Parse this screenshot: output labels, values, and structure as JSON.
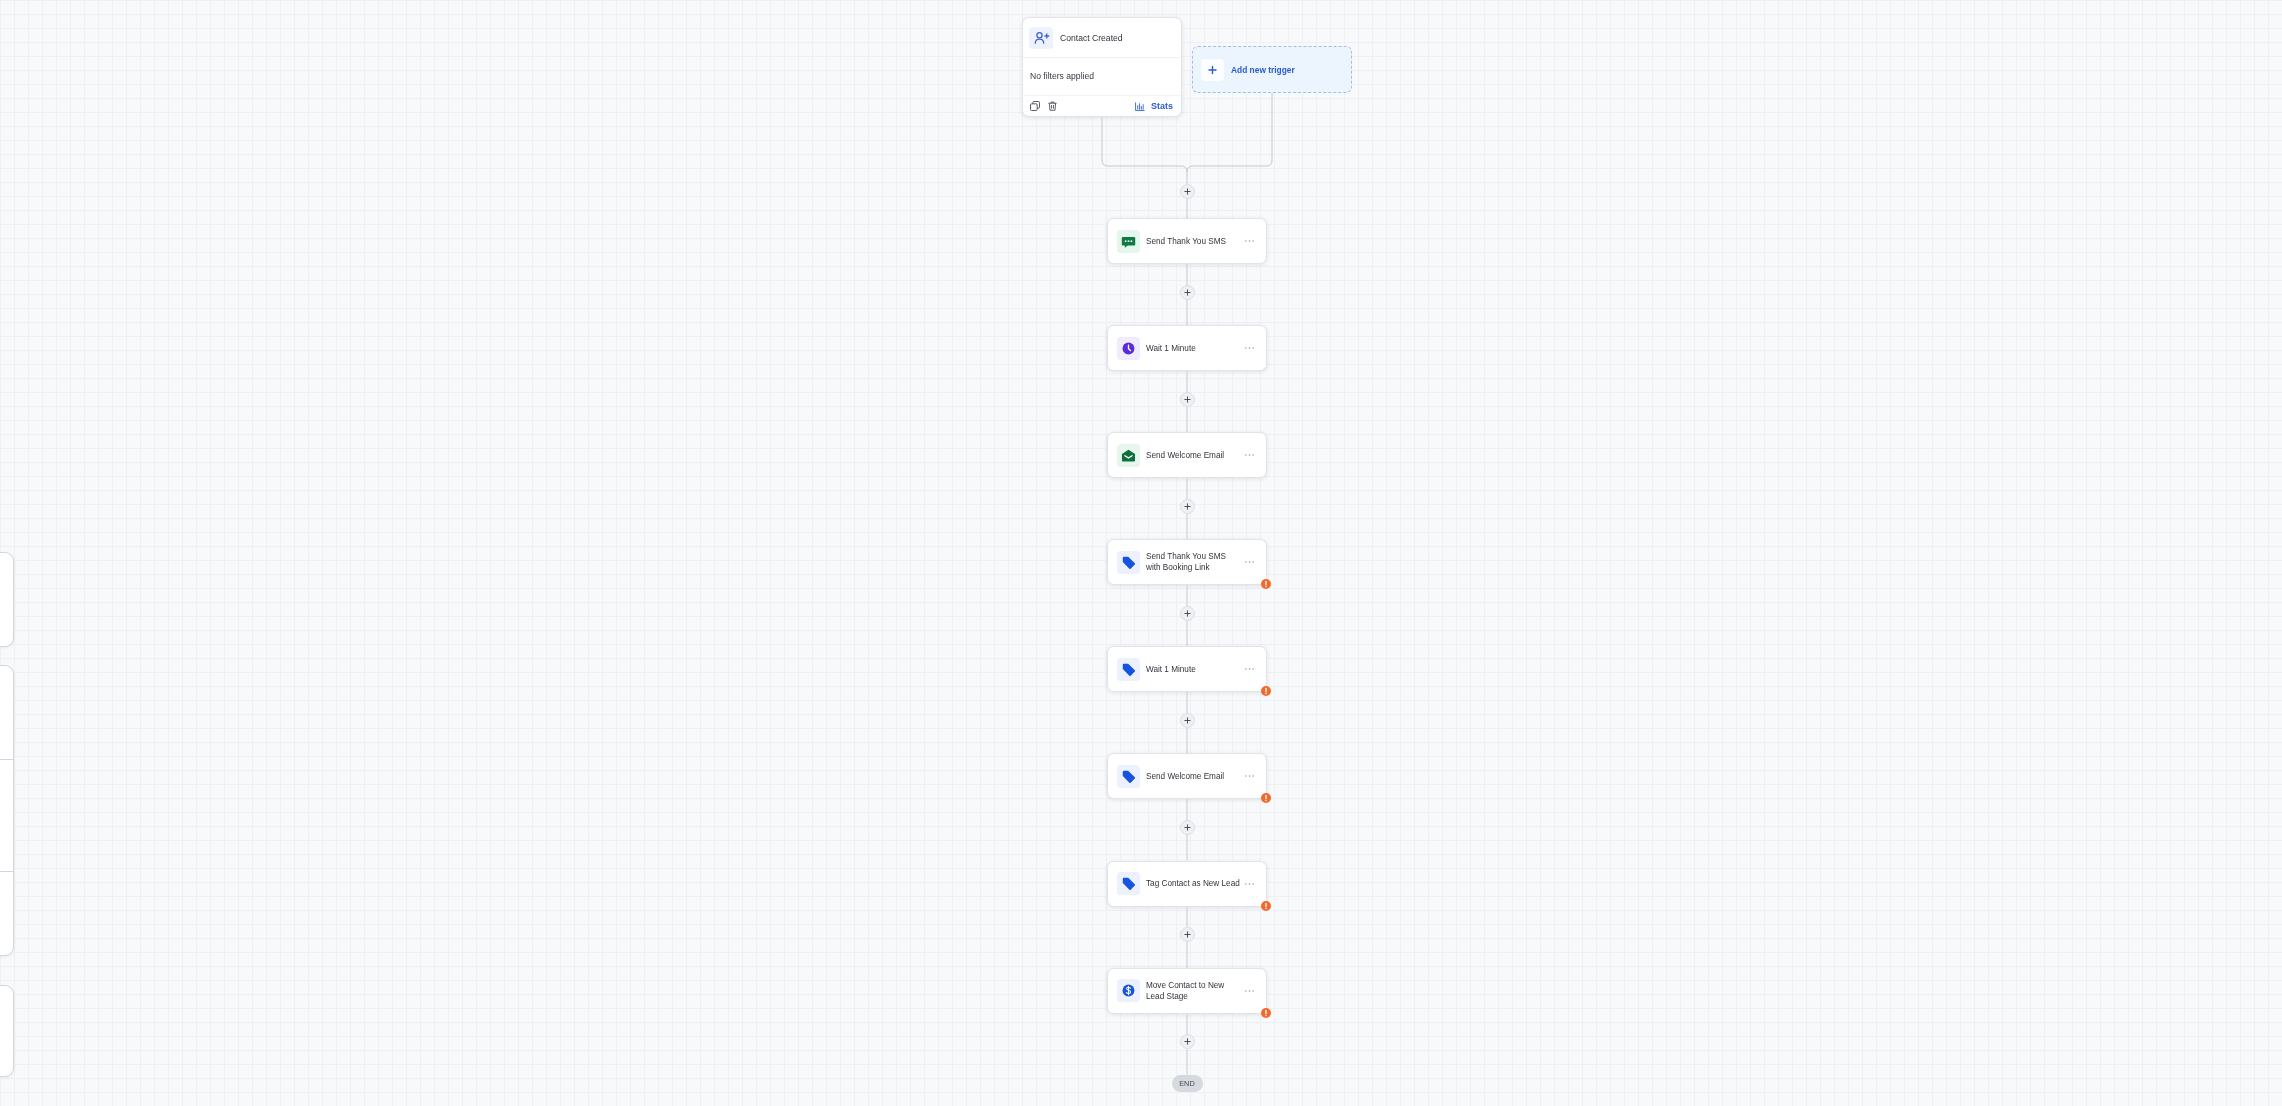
{
  "trigger": {
    "title": "Contact Created",
    "filter_summary": "No filters applied",
    "stats_label": "Stats"
  },
  "add_trigger": {
    "label": "Add new trigger"
  },
  "steps": [
    {
      "kind": "sms",
      "label": "Send Thank You SMS",
      "warning": false
    },
    {
      "kind": "wait",
      "label": "Wait 1 Minute",
      "warning": false
    },
    {
      "kind": "email",
      "label": "Send Welcome Email",
      "warning": false
    },
    {
      "kind": "tag",
      "label": "Send Thank You SMS with Booking Link",
      "warning": true
    },
    {
      "kind": "tag",
      "label": "Wait 1 Minute",
      "warning": true
    },
    {
      "kind": "tag",
      "label": "Send Welcome Email",
      "warning": true
    },
    {
      "kind": "tag",
      "label": "Tag Contact as New Lead",
      "warning": true
    },
    {
      "kind": "opportunity",
      "label": "Move Contact to New Lead Stage",
      "warning": true
    }
  ],
  "end": {
    "label": "END"
  }
}
